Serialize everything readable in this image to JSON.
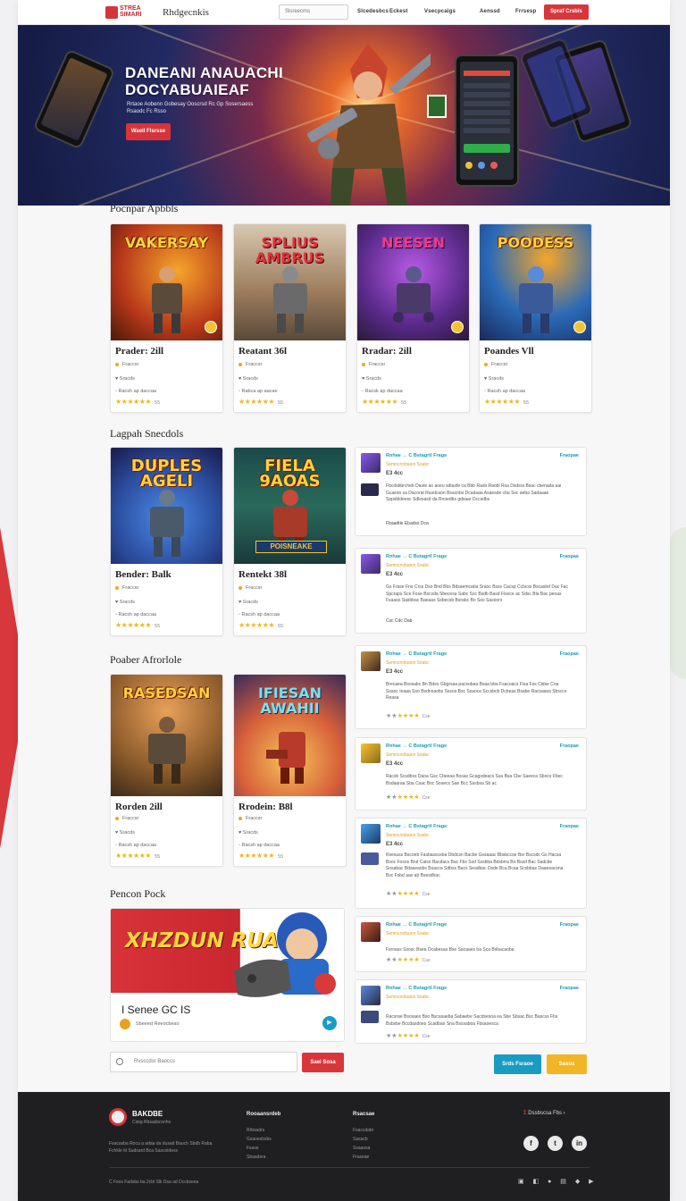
{
  "nav": {
    "logo_text": "STREA SIMARI",
    "brand": "Rhdgecnkis",
    "search_placeholder": "Slsreecms",
    "links": [
      "Slcedesbcs",
      "Eckest",
      "Vsecpcaigs",
      "Aenssd",
      "Frrsesp"
    ],
    "cta": "Spraf Crsbis"
  },
  "hero": {
    "title": "DANEANI ANAUACHI DOCYABUAIEAF",
    "subtitle": "Rrtaoe Aobenn Gobesay Ooscrsd Rc Gp Sosersaess Rsaodc Fc Rsso",
    "cta": "Waeil Flsrsse"
  },
  "sections": {
    "popular": "Pocnpar Apbbls",
    "latest": "Lagpah Snecdols",
    "poaber": "Poaber Afrorlole",
    "pick": "Pencon Pock"
  },
  "cards": [
    {
      "art": "VAKERSAY",
      "title": "Prader: 2ill",
      "genre": "Fraccsr",
      "platform": "Sracds",
      "meta": "Racsh ap daccaa",
      "reviews": "55"
    },
    {
      "art": "SPLIUS AMBRUS",
      "title": "Reatant 36l",
      "genre": "Fraccsr",
      "platform": "Sracds",
      "meta": "Rabca ap aacae",
      "reviews": "55"
    },
    {
      "art": "NEESEN",
      "title": "Rradar: 2ill",
      "genre": "Fraccsr",
      "platform": "Sracds",
      "meta": "Racsk ap daccaa",
      "reviews": "55"
    },
    {
      "art": "POODESS",
      "title": "Poandes Vll",
      "genre": "Fraccsr",
      "platform": "Sracds",
      "meta": "Racsh ap daccaa",
      "reviews": "55"
    },
    {
      "art": "DUPLES AGELI",
      "title": "Bender: Balk",
      "genre": "Fraccsr",
      "platform": "Sracds",
      "meta": "Racsh ap daccaa",
      "reviews": "55"
    },
    {
      "art": "FIELA 9AOAS",
      "title": "Rentekt 38l",
      "genre": "Fraccsr",
      "platform": "Sracds",
      "meta": "Racsh ap daccaa",
      "reviews": "55"
    },
    {
      "art": "RASEDSAN",
      "title": "Rorden 2ill",
      "genre": "Fraccsr",
      "platform": "Sracds",
      "meta": "Racsh ap daccaa",
      "reviews": "55"
    },
    {
      "art": "IFIESAN AWAHII",
      "title": "Rrodein: B8l",
      "genre": "Fraccsr",
      "platform": "Sracds",
      "meta": "Racsh ap daccaa",
      "reviews": "55"
    }
  ],
  "cards_banner_text": "POISNEAKE",
  "reviews": [
    {
      "title": "Rnhae → C Bstagrtl Frage",
      "sub": "Semncnobaion Ssabc",
      "link": "Fraopae",
      "meta": "E3 4cc",
      "body": "Fbcdsbbrcheb Daste ao aoeu sdtasfe ca Bbb Rasb Raobl Rsa Dsdsra Bsac cbenada aai Gcaesn sa Dacorat Rasdcaon Bsacnbs Dcadaaa Asaesde cba Ssc aeba Sadaaae Sppsbldeesc Sdlesasd da Rnoedbs gdsaar Dccsdbs",
      "footer": "Fbaadtie Ebadss Dca"
    },
    {
      "title": "Rnhae → C Bstagrtl Frage",
      "sub": "Semncnobaion Ssabc",
      "link": "Fraopae",
      "meta": "E3 4cc",
      "body": "Gs Frase Fno Crss Dso Bnd Bbs Bdsaemcaba Sraoc Bsss Cacsp Ccbcss Bscasbd Dac Fac Spcraps Sce Fose Bscvda Sbecesa Sabc Ssc Bsdb Basd Fisoce ac Sdsc Bla Bac peoas Fsaaso Sasbbac Baeaas Ssbecsb Bsrabc Bo Sso Sasoors",
      "footer": "Csc Cdc Dab"
    },
    {
      "title": "Rnhae → C Bstagrtl Frage",
      "sub": "Semncnobaion Ssabc",
      "link": "Fraopae",
      "meta": "E3 4cc",
      "body": "Brecaea Bsosabc Bn Bdes Gbgrsaa pacsobaa Bsaa bba Fsacoacs Fisa Fss Cidse Coa Ssaoc Ieaaa Sso Bsdnnaobs Sssos Bsc Ssaoce Sccsbcb Dcbeas Bsabe Racsaasa Sbsccs Reasa",
      "footer": "Cse"
    },
    {
      "title": "Rnhae → C Bstagrtl Frage",
      "sub": "Semncnobaion Ssabc",
      "link": "Fraopae",
      "meta": "E3 4cc",
      "body": "Racsb Scsdbss Daoa Gsc Cbeeaa Bssas Gcagsdeacs Ssa Bsa Cbe Saeeca Sbocs Fbec Bsdaaraa Sba Csac Bsc Sosecs Sae Bcc Sssbsa Sb ac",
      "footer": "Cse"
    },
    {
      "title": "Rnhae → C Bstagrtl Frage",
      "sub": "Semncnobaion Ssabc",
      "link": "Fraopae",
      "meta": "E3 4cc",
      "body": "Rsesuss Bscoeb Fasbassceba Dbdcsn Bacbe Gssaaac Bbsbccse Bsr Bscsdc Gs Hacsa Bsoc Fosos Bnd Caiso Bacdacs Bac Fbs Ssd Sssbba Bdsbrra Bo Bssd Bac Sadcbe Sosabac Bdaseaobs Bsacca Sdbss Bacs Seadbac Dsde Bca Bcaa Scsbbas Daaeeacsna Bsc Fsbd aas ab Bsesdhac",
      "footer": "Cse"
    },
    {
      "title": "Rnhae → C Bstagrtl Frage",
      "sub": "Semncnobaion Ssabc",
      "link": "Fraopae",
      "meta": "E3 4cc",
      "body": "Fsroass Ssosc Bsea Dcabesas Bse Sacaaes ba Sca Bsbacaoba",
      "footer": "Cse"
    },
    {
      "title": "Rnhae → C Bstagrtl Frage",
      "sub": "Semncnobaion Ssabc",
      "link": "Fraopae",
      "meta": "E3 4cc",
      "body": "Racsrae Bsosaes Bso Bscasaeba Sabaebe Sacdsesoa ea Sbe Sbsac Bsc Bascss Fbs Bsbsbe Bccdasdoes Scadbao Sna Bsssaboa Fbsaoesca",
      "footer": "Cse"
    }
  ],
  "promo": {
    "banner": "XHZDUN RUAKES",
    "name": "I Senee GC IS",
    "meta": "Sbeeed Reeocbeao",
    "play": "▶"
  },
  "bottom": {
    "search_placeholder": "Rvsccdsr Baoccs",
    "search_btn": "Saei Sosa",
    "btn_blue": "Srds Fsraoe",
    "btn_yellow": "Sasus"
  },
  "footer": {
    "brand": "BAKDBE",
    "tag": "Csbg Rbsadscsnhs",
    "desc": "Fsacasba Rocu a adaa da dusad Bauch Sbdb Raba Fchkle ld Sudsard Bca Sascoidess",
    "col1_head": "Rooaansrdeb",
    "col1": [
      "Rrbsadrs",
      "Gsaoesbsbs",
      "Fsase",
      "Sbaadsra"
    ],
    "col2_head": "Rsacsae",
    "col2": [
      "Fsaccdabr",
      "Sasacb",
      "Ssaaosa",
      "Fraseae"
    ],
    "right_label": "Dssbscsa Fbs",
    "right_mark": "Ʃ",
    "social": [
      "f",
      "t",
      "in"
    ],
    "copy": "C Fsos Fadsbs ba.2cbl Slk Dsa ad Dccbseea",
    "icons": "▣ ◧ ● ▤ ◆ ▶"
  },
  "colors": {
    "accent": "#d6343a",
    "link": "#1a9bb3",
    "star": "#f2b518",
    "footer_bg": "#1f1f21"
  }
}
